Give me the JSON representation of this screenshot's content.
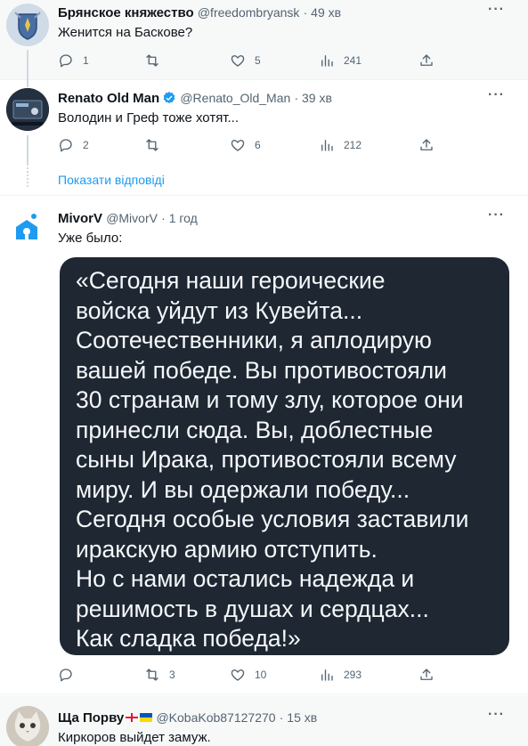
{
  "tweets": [
    {
      "name": "Брянское княжество",
      "handle": "@freedombryansk",
      "time": "· 49 хв",
      "text": "Женится на Баскове?",
      "replies": "1",
      "retweets": "",
      "likes": "5",
      "views": "241"
    },
    {
      "name": "Renato Old Man",
      "handle": "@Renato_Old_Man",
      "time": "· 39 хв",
      "text": "Володин и Греф тоже хотят...",
      "replies": "2",
      "retweets": "",
      "likes": "6",
      "views": "212"
    },
    {
      "name": "MivorV",
      "handle": "@MivorV",
      "time": "· 1 год",
      "text": "Уже было:",
      "quote": "«Сегодня наши героические\nвойска уйдут из Кувейта...\nСоотечественники, я аплодирую\nвашей победе. Вы противостояли\n30 странам и тому злу, которое они\nпринесли сюда. Вы, доблестные\nсыны Ирака, противостояли всему\nмиру. И вы одержали победу...\nСегодня особые условия заставили\nиракскую армию отступить.\nНо с нами остались надежда и\nрешимость в душах и сердцах...\nКак сладка победа!»",
      "replies": "",
      "retweets": "3",
      "likes": "10",
      "views": "293"
    },
    {
      "name": "Ща Порву",
      "handle": "@KobaKob87127270",
      "time": "· 15 хв",
      "text": "Киркоров выйдет замуж."
    }
  ],
  "show_replies": "Показати відповіді",
  "more_label": "···",
  "colors": {
    "accent": "#1d9bf0",
    "muted": "#536471",
    "card": "#1e2732"
  }
}
